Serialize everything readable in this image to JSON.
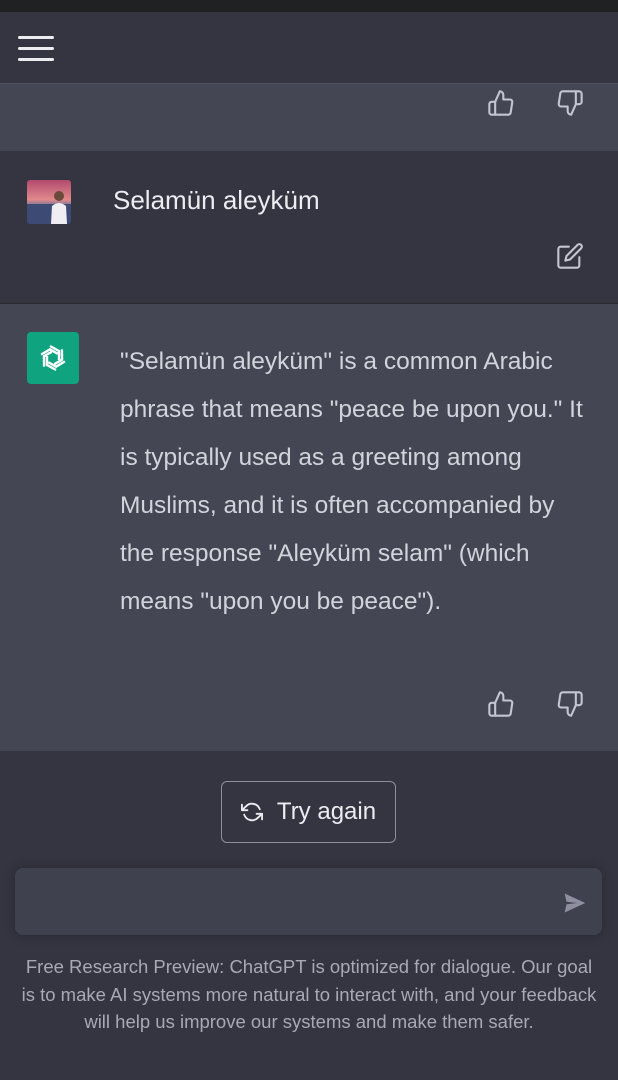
{
  "header": {
    "menu_icon": "hamburger-menu-icon"
  },
  "conversation": {
    "user_message": {
      "text": "Selamün aleyküm",
      "avatar": "user-avatar-photo",
      "edit_icon": "edit-icon"
    },
    "assistant_message": {
      "text": "\"Selamün aleyküm\" is a common Arabic phrase that means \"peace be upon you.\" It is typically used as a greeting among Muslims, and it is often accompanied by the response \"Aleyküm selam\" (which means \"upon you be peace\").",
      "avatar": "openai-logo-icon",
      "feedback_icons": [
        "thumbs-up-icon",
        "thumbs-down-icon"
      ]
    }
  },
  "actions": {
    "try_again_label": "Try again",
    "try_again_icon": "refresh-icon"
  },
  "composer": {
    "value": "",
    "send_icon": "send-icon"
  },
  "footer": {
    "text": "Free Research Preview: ChatGPT is optimized for dialogue. Our goal is to make AI systems more natural to interact with, and your feedback will help us improve our systems and make them safer."
  },
  "colors": {
    "background": "#343541",
    "assistant_background": "#444654",
    "accent": "#10a37f"
  }
}
